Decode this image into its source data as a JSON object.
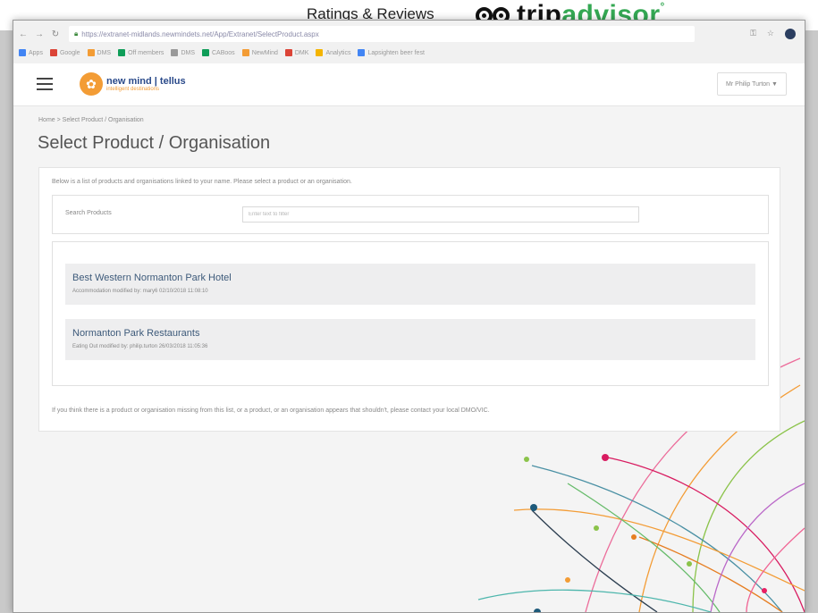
{
  "banner": {
    "title": "Ratings & Reviews",
    "logo_trip": "trip",
    "logo_advisor": "advisor",
    "logo_mark": "°"
  },
  "browser": {
    "url": "https://extranet-midlands.newmindets.net/App/Extranet/SelectProduct.aspx",
    "bookmarks": [
      {
        "label": "Apps",
        "color": "#4285f4"
      },
      {
        "label": "Google",
        "color": "#db4437"
      },
      {
        "label": "DMS",
        "color": "#f39c35"
      },
      {
        "label": "Off members",
        "color": "#0f9d58"
      },
      {
        "label": "DMS",
        "color": "#999999"
      },
      {
        "label": "CABoos",
        "color": "#0f9d58"
      },
      {
        "label": "NewMind",
        "color": "#f39c35"
      },
      {
        "label": "DMK",
        "color": "#db4437"
      },
      {
        "label": "Analytics",
        "color": "#f4b400"
      },
      {
        "label": "Lapsighten beer fest",
        "color": "#4285f4"
      }
    ]
  },
  "header": {
    "logo_main": "new mind | tellus",
    "logo_sub": "intelligent destinations",
    "user_label": "Mr Philip Turton ▼"
  },
  "breadcrumb": "Home > Select Product / Organisation",
  "page_title": "Select Product / Organisation",
  "intro": "Below is a list of products and organisations linked to your name. Please select a product or an organisation.",
  "search": {
    "label": "Search Products",
    "placeholder": "Enter text to filter"
  },
  "results": [
    {
      "name": "Best Western Normanton Park Hotel",
      "meta": "Accommodation modified by: mary6 02/10/2018 11:08:10"
    },
    {
      "name": "Normanton Park Restaurants",
      "meta": "Eating Out modified by: philip.turton 26/03/2018 11:05:36"
    }
  ],
  "footer_note": "If you think there is a product or organisation missing from this list, or a product, or an organisation appears that shouldn't, please contact your local DMO/VIC.",
  "colors": {
    "accent": "#3d5a7a",
    "brand_orange": "#f39c35",
    "tripadvisor_green": "#34a853"
  }
}
